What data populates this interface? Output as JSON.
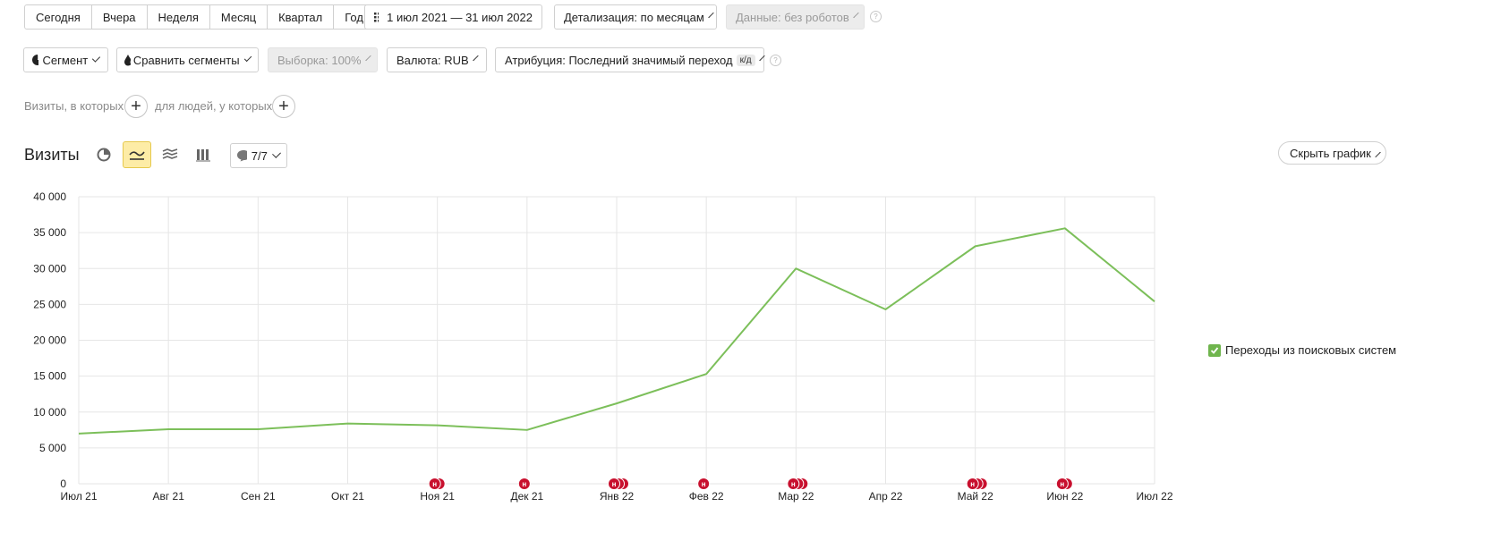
{
  "periods": [
    "Сегодня",
    "Вчера",
    "Неделя",
    "Месяц",
    "Квартал",
    "Год"
  ],
  "date_range": "1 июл 2021 — 31 июл 2022",
  "detail": "Детализация: по месяцам",
  "data_filter": "Данные: без роботов",
  "segment": "Сегмент",
  "compare": "Сравнить сегменты",
  "sample": "Выборка: 100%",
  "currency": "Валюта: RUB",
  "attribution": "Атрибуция: Последний значимый переход",
  "attribution_badge": "к/д",
  "filter_visits": "Визиты, в которых",
  "filter_people": "для людей, у которых",
  "chart_title": "Визиты",
  "annotations_count": "7/7",
  "hide_chart": "Скрыть график",
  "legend_label": "Переходы из поисковых систем",
  "help_mark": "?",
  "marker_letter": "н",
  "colors": {
    "line": "#7cbf5a",
    "marker": "#c8102e",
    "active_icon": "#fdeca6"
  },
  "chart_data": {
    "type": "line",
    "title": "",
    "xlabel": "",
    "ylabel": "",
    "categories": [
      "Июл 21",
      "Авг 21",
      "Сен 21",
      "Окт 21",
      "Ноя 21",
      "Дек 21",
      "Янв 22",
      "Фев 22",
      "Мар 22",
      "Апр 22",
      "Май 22",
      "Июн 22",
      "Июл 22"
    ],
    "series": [
      {
        "name": "Переходы из поисковых систем",
        "values": [
          7000,
          7600,
          7600,
          8400,
          8150,
          7500,
          11200,
          15300,
          30000,
          24300,
          33100,
          35600,
          25400
        ]
      }
    ],
    "ylim": [
      0,
      40000
    ],
    "yticks": [
      0,
      5000,
      10000,
      15000,
      20000,
      25000,
      30000,
      35000,
      40000
    ],
    "ytick_labels": [
      "0",
      "5 000",
      "10 000",
      "15 000",
      "20 000",
      "25 000",
      "30 000",
      "35 000",
      "40 000"
    ],
    "grid": true,
    "legend_position": "right",
    "annotation_markers": [
      {
        "category": "Ноя 21",
        "count": 2
      },
      {
        "category": "Дек 21",
        "count": 1
      },
      {
        "category": "Янв 22",
        "count": 3
      },
      {
        "category": "Фев 22",
        "count": 1
      },
      {
        "category": "Мар 22",
        "count": 3
      },
      {
        "category": "Май 22",
        "count": 3
      },
      {
        "category": "Июн 22",
        "count": 2
      }
    ]
  }
}
